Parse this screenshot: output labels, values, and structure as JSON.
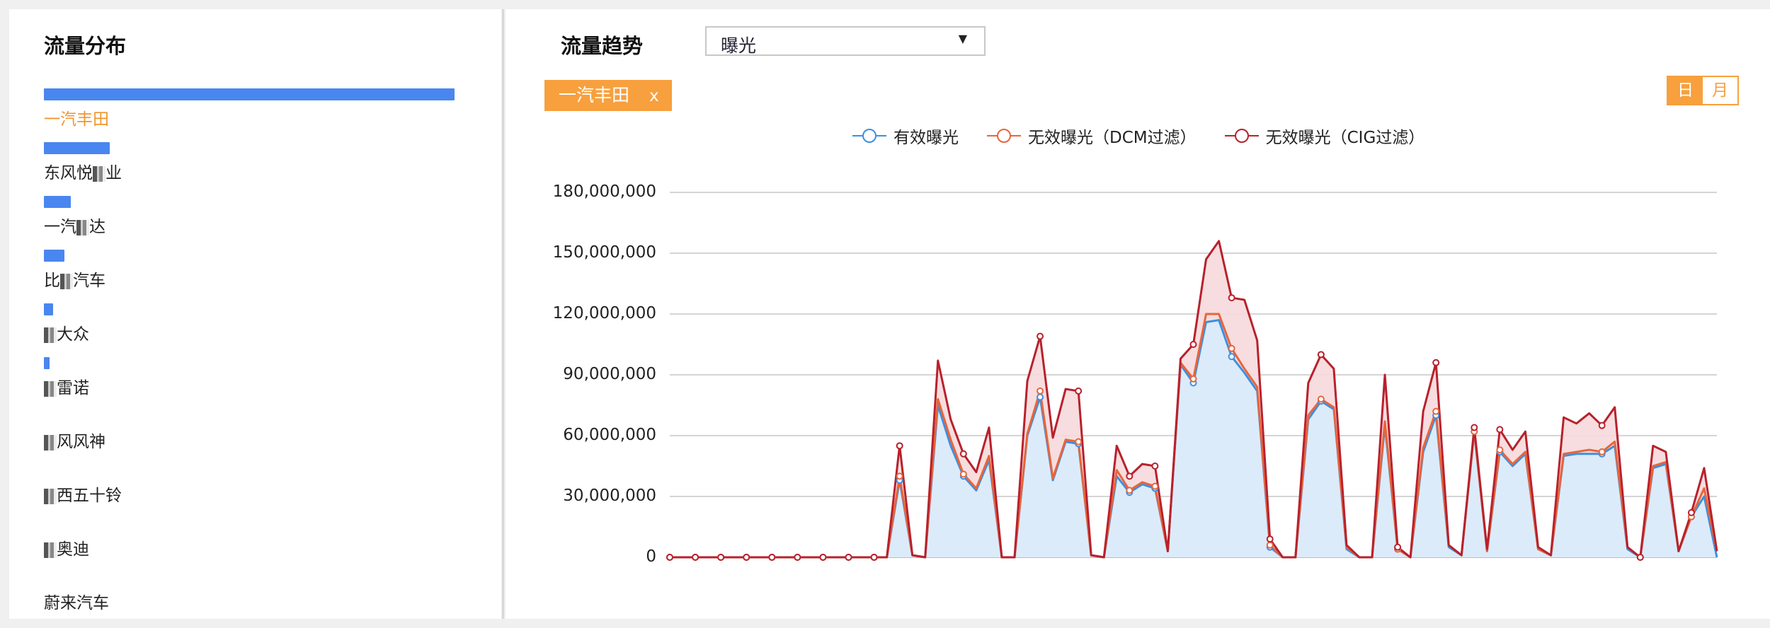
{
  "left": {
    "title": "流量分布",
    "items": [
      {
        "label": "一汽丰田",
        "value": 100,
        "active": true
      },
      {
        "label": "东风悦",
        "suffix": "业",
        "value": 16
      },
      {
        "label": "一汽",
        "suffix": "达",
        "value": 6.5
      },
      {
        "label": "比",
        "suffix": "汽车",
        "value": 5
      },
      {
        "label": "",
        "suffix": "大众",
        "value": 2.2
      },
      {
        "label": "",
        "suffix": "雷诺",
        "value": 1.3
      },
      {
        "label": "",
        "suffix": "风风神",
        "value": 0
      },
      {
        "label": "",
        "suffix": "西五十铃",
        "value": 0
      },
      {
        "label": "",
        "suffix": "奥迪",
        "value": 0
      },
      {
        "label": "蔚来汽车",
        "suffix": "",
        "value": 0
      }
    ]
  },
  "right": {
    "title": "流量趋势",
    "metric_select": "曝光",
    "filter_tag": "一汽丰田",
    "filter_close": "x",
    "granularity": {
      "day": "日",
      "month": "月",
      "selected": "day"
    }
  },
  "colors": {
    "accent": "#f7a03d",
    "bar": "#4a86f0",
    "valid": "#3d8fe0",
    "dcm": "#e8653a",
    "cig": "#b8212c",
    "area_valid": "#dcebfa",
    "area_cig": "#f6d9dc"
  },
  "chart_data": {
    "type": "area",
    "legend": [
      "有效曝光",
      "无效曝光（DCM过滤）",
      "无效曝光（CIG过滤）"
    ],
    "legend_position": "top-center",
    "y_ticks": [
      "0",
      "30,000,000",
      "60,000,000",
      "90,000,000",
      "120,000,000",
      "150,000,000",
      "180,000,000"
    ],
    "ylim": [
      0,
      180000000
    ],
    "grid": true,
    "series": [
      {
        "name": "有效曝光",
        "values": [
          0,
          0,
          0,
          0,
          0,
          0,
          0,
          0,
          0,
          0,
          0,
          0,
          0,
          0,
          0,
          0,
          0,
          0,
          38000000,
          1000000,
          0,
          75000000,
          55000000,
          40000000,
          33000000,
          48000000,
          0,
          0,
          60000000,
          79000000,
          38000000,
          57000000,
          56000000,
          1000000,
          0,
          40000000,
          32000000,
          36000000,
          34000000,
          3000000,
          95000000,
          86000000,
          116000000,
          117000000,
          99000000,
          91000000,
          82000000,
          5000000,
          0,
          0,
          68000000,
          77000000,
          73000000,
          4000000,
          0,
          0,
          65000000,
          4000000,
          0,
          52000000,
          70000000,
          5000000,
          1000000,
          62000000,
          3000000,
          52000000,
          45000000,
          51000000,
          4000000,
          1000000,
          50000000,
          51000000,
          51000000,
          51000000,
          55000000,
          4000000,
          0,
          44000000,
          46000000,
          3000000,
          20000000,
          30000000,
          0
        ]
      },
      {
        "name": "无效曝光（DCM过滤）",
        "values": [
          0,
          0,
          0,
          0,
          0,
          0,
          0,
          0,
          0,
          0,
          0,
          0,
          0,
          0,
          0,
          0,
          0,
          0,
          40000000,
          1000000,
          0,
          78000000,
          58000000,
          41000000,
          34000000,
          50000000,
          0,
          0,
          61000000,
          82000000,
          39000000,
          58000000,
          57000000,
          1000000,
          0,
          43000000,
          33000000,
          37000000,
          35000000,
          3000000,
          96000000,
          88000000,
          120000000,
          120000000,
          103000000,
          93000000,
          84000000,
          6000000,
          0,
          0,
          70000000,
          78000000,
          74000000,
          5000000,
          0,
          0,
          67000000,
          4000000,
          0,
          54000000,
          72000000,
          6000000,
          1000000,
          62000000,
          3000000,
          53000000,
          46000000,
          52000000,
          4000000,
          1000000,
          51000000,
          52000000,
          53000000,
          52000000,
          57000000,
          5000000,
          0,
          45000000,
          47000000,
          3000000,
          20000000,
          34000000,
          3000000
        ]
      },
      {
        "name": "无效曝光（CIG过滤）",
        "values": [
          0,
          0,
          0,
          0,
          0,
          0,
          0,
          0,
          0,
          0,
          0,
          0,
          0,
          0,
          0,
          0,
          0,
          0,
          55000000,
          1000000,
          0,
          97000000,
          68000000,
          51000000,
          42000000,
          64000000,
          0,
          0,
          87000000,
          109000000,
          59000000,
          83000000,
          82000000,
          1000000,
          0,
          55000000,
          40000000,
          46000000,
          45000000,
          3000000,
          98000000,
          105000000,
          147000000,
          156000000,
          128000000,
          127000000,
          107000000,
          9000000,
          0,
          0,
          86000000,
          100000000,
          93000000,
          6000000,
          0,
          0,
          90000000,
          5000000,
          0,
          72000000,
          96000000,
          6000000,
          1000000,
          64000000,
          4000000,
          63000000,
          53000000,
          62000000,
          5000000,
          1000000,
          69000000,
          66000000,
          71000000,
          65000000,
          74000000,
          5000000,
          0,
          55000000,
          52000000,
          3000000,
          22000000,
          44000000,
          3000000
        ]
      }
    ]
  }
}
